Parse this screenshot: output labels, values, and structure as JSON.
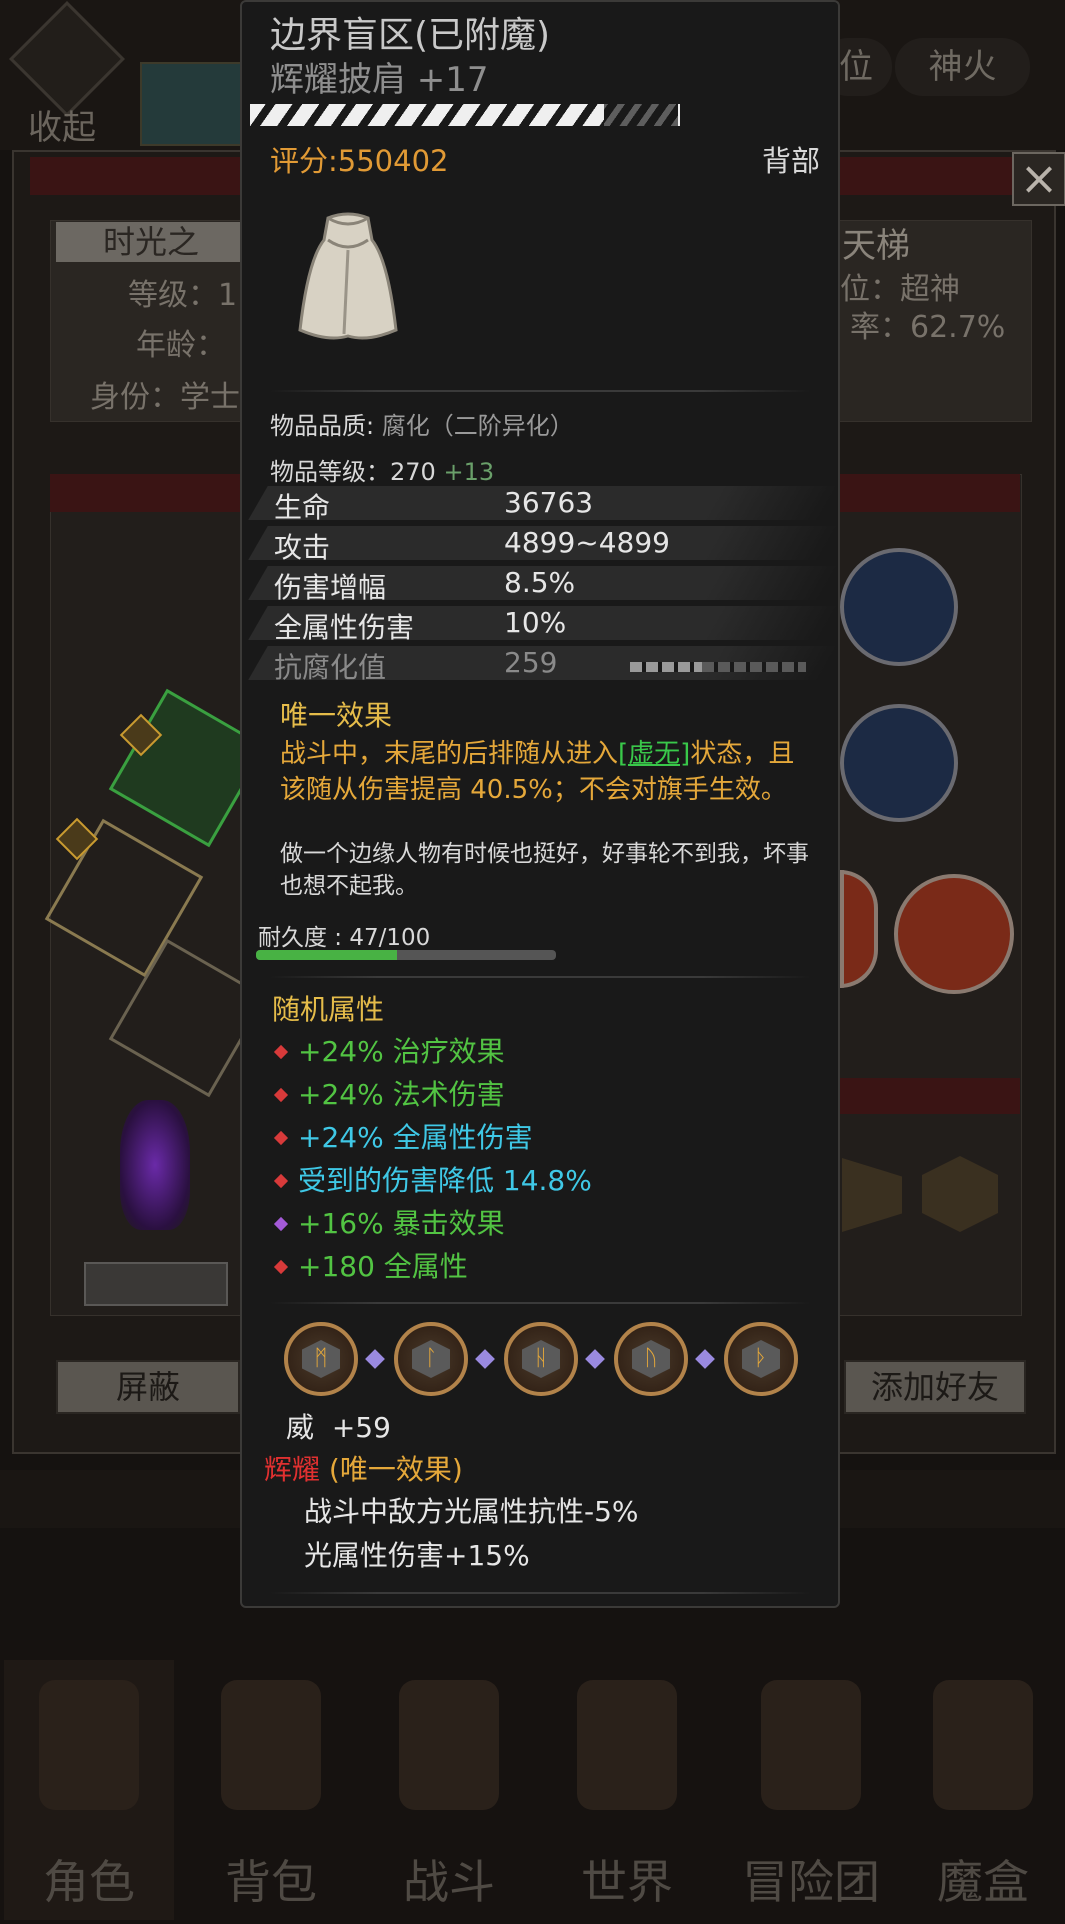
{
  "background": {
    "collapse_label": "收起",
    "top_tabs": [
      "位",
      "神火"
    ],
    "player": {
      "name_plate": "时光之",
      "level_label": "等级：1",
      "age_label": "年龄：",
      "identity_label": "身份：学士"
    },
    "ladder": {
      "title": "天梯",
      "rank_label": "位：超神",
      "rate_label": "率：62.7%"
    },
    "block_button": "屏蔽",
    "add_friend_button": "添加好友",
    "nav": [
      "角色",
      "背包",
      "战斗",
      "世界",
      "冒险团",
      "魔盒"
    ]
  },
  "tooltip": {
    "name": "边界盲区",
    "enchant_tag": "(已附魔)",
    "subtitle": "辉耀披肩 +17",
    "score": "评分:550402",
    "slot": "背部",
    "quality_label": "物品品质:",
    "quality_value": "腐化（二阶异化）",
    "level_label": "物品等级：",
    "level_value": "270",
    "level_plus": "+13",
    "stats": [
      {
        "name": "生命",
        "value": "36763"
      },
      {
        "name": "攻击",
        "value": "4899~4899"
      },
      {
        "name": "伤害增幅",
        "value": "8.5%"
      },
      {
        "name": "全属性伤害",
        "value": "10%"
      },
      {
        "name": "抗腐化值",
        "value": "259"
      }
    ],
    "unique_header": "唯一效果",
    "unique_text_1": "战斗中，末尾的后排随从进入",
    "unique_link": "[虚无]",
    "unique_text_2": "状态，且该随从伤害提高 40.5%；不会对旗手生效。",
    "flavor": "做一个边缘人物有时候也挺好，好事轮不到我，坏事也想不起我。",
    "durability_label": "耐久度 : 47/100",
    "durability_fraction": 0.47,
    "random_header": "随机属性",
    "random": [
      {
        "text": "+24% 治疗效果",
        "color": "#52c443",
        "gem": "#d83a3a"
      },
      {
        "text": "+24% 法术伤害",
        "color": "#52c443",
        "gem": "#d83a3a"
      },
      {
        "text": "+24% 全属性伤害",
        "color": "#3fc8e6",
        "gem": "#d83a3a"
      },
      {
        "text": "受到的伤害降低 14.8%",
        "color": "#3fc8e6",
        "gem": "#d83a3a"
      },
      {
        "text": "+16% 暴击效果",
        "color": "#52c443",
        "gem": "#a45ad8"
      },
      {
        "text": "+180 全属性",
        "color": "#52c443",
        "gem": "#d83a3a"
      }
    ],
    "rune_count": 5,
    "wei_label": "威",
    "wei_value": "+59",
    "shine_label": "辉耀",
    "shine_tag": "(唯一效果)",
    "shine_lines": [
      "战斗中敌方光属性抗性-5%",
      "光属性伤害+15%"
    ],
    "colors": {
      "score": "#e19a35",
      "unique": "#e5a83a",
      "shine_label": "#e03030",
      "shine_tag": "#e5a83a"
    }
  }
}
